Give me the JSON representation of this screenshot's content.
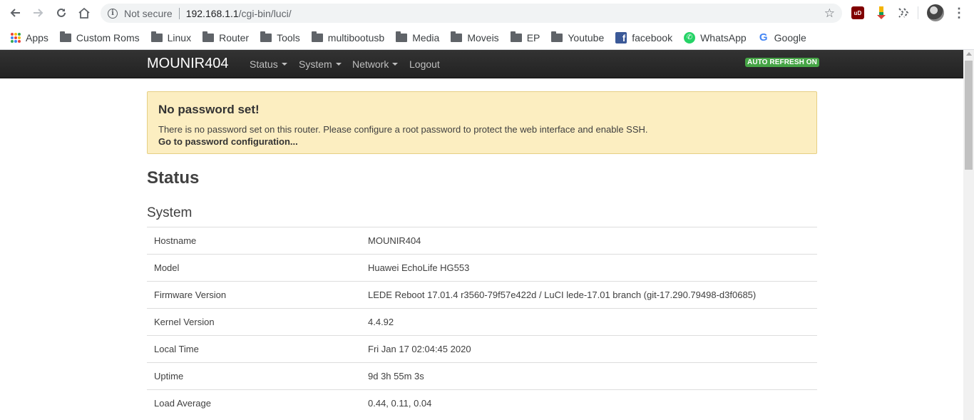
{
  "browser": {
    "security_label": "Not secure",
    "url_host": "192.168.1.1",
    "url_path": "/cgi-bin/luci/",
    "extensions": [
      {
        "name": "ublock-origin-icon",
        "text": "uD",
        "color": "#800000"
      },
      {
        "name": "download-extension-icon",
        "text": "",
        "color": "#f4b400"
      },
      {
        "name": "share-extension-icon",
        "text": "",
        "color": "#5f6368"
      }
    ],
    "bookmarks": [
      {
        "label": "Apps",
        "icon": "apps-icon"
      },
      {
        "label": "Custom Roms",
        "icon": "folder-icon"
      },
      {
        "label": "Linux",
        "icon": "folder-icon"
      },
      {
        "label": "Router",
        "icon": "folder-icon"
      },
      {
        "label": "Tools",
        "icon": "folder-icon"
      },
      {
        "label": "multibootusb",
        "icon": "folder-icon"
      },
      {
        "label": "Media",
        "icon": "folder-icon"
      },
      {
        "label": "Moveis",
        "icon": "folder-icon"
      },
      {
        "label": "EP",
        "icon": "folder-icon"
      },
      {
        "label": "Youtube",
        "icon": "folder-icon"
      },
      {
        "label": "facebook",
        "icon": "facebook-icon"
      },
      {
        "label": "WhatsApp",
        "icon": "whatsapp-icon"
      },
      {
        "label": "Google",
        "icon": "google-icon"
      }
    ]
  },
  "navbar": {
    "brand": "MOUNIR404",
    "menu": [
      "Status",
      "System",
      "Network"
    ],
    "logout": "Logout",
    "auto_refresh": "AUTO REFRESH ON"
  },
  "alert": {
    "title": "No password set!",
    "text": "There is no password set on this router. Please configure a root password to protect the web interface and enable SSH.",
    "link": "Go to password configuration..."
  },
  "main": {
    "title": "Status",
    "section": "System",
    "rows": [
      {
        "key": "Hostname",
        "value": "MOUNIR404"
      },
      {
        "key": "Model",
        "value": "Huawei EchoLife HG553"
      },
      {
        "key": "Firmware Version",
        "value": "LEDE Reboot 17.01.4 r3560-79f57e422d / LuCI lede-17.01 branch (git-17.290.79498-d3f0685)"
      },
      {
        "key": "Kernel Version",
        "value": "4.4.92"
      },
      {
        "key": "Local Time",
        "value": "Fri Jan 17 02:04:45 2020"
      },
      {
        "key": "Uptime",
        "value": "9d 3h 55m 3s"
      },
      {
        "key": "Load Average",
        "value": "0.44, 0.11, 0.04"
      }
    ]
  }
}
